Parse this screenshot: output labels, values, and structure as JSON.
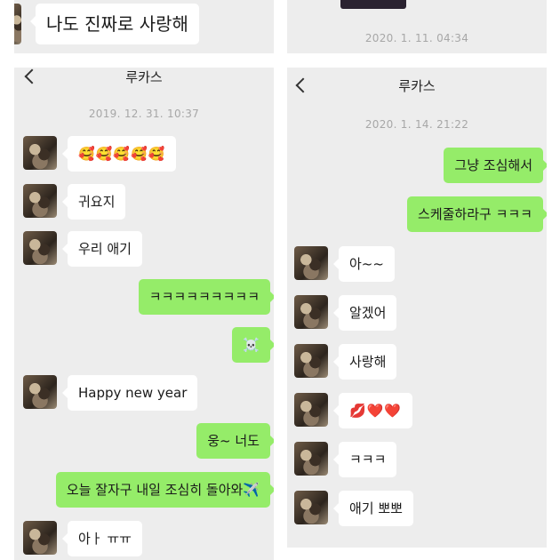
{
  "top_left": {
    "message": "나도 진짜로 사랑해"
  },
  "top_right": {
    "timestamp": "2020. 1. 11. 04:34"
  },
  "left_chat": {
    "contact_name": "루카스",
    "timestamp": "2019. 12. 31. 10:37",
    "messages": [
      {
        "side": "in",
        "text": "🥰🥰🥰🥰🥰"
      },
      {
        "side": "in",
        "text": "귀요지"
      },
      {
        "side": "in",
        "text": "우리 애기"
      },
      {
        "side": "out",
        "text": "ㅋㅋㅋㅋㅋㅋㅋㅋㅋ"
      },
      {
        "side": "out",
        "text": "☠️"
      },
      {
        "side": "in",
        "text": "Happy new year"
      },
      {
        "side": "out",
        "text": "웅~ 너도"
      },
      {
        "side": "out",
        "text": "오늘 잘자구 내일 조심히 돌아와✈️"
      },
      {
        "side": "in",
        "text": "아ㅏ ㅠㅠ"
      }
    ]
  },
  "right_chat": {
    "contact_name": "루카스",
    "timestamp": "2020. 1. 14. 21:22",
    "messages": [
      {
        "side": "out",
        "text": "그냥 조심해서"
      },
      {
        "side": "out",
        "text": "스케줄하라구 ㅋㅋㅋ"
      },
      {
        "side": "in",
        "text": "아~~"
      },
      {
        "side": "in",
        "text": "알겠어"
      },
      {
        "side": "in",
        "text": "사랑해"
      },
      {
        "side": "in",
        "text": "💋❤️❤️"
      },
      {
        "side": "in",
        "text": "ㅋㅋㅋ"
      },
      {
        "side": "in",
        "text": "애기 뽀뽀"
      }
    ]
  },
  "colors": {
    "outgoing_bubble": "#95ec69",
    "incoming_bubble": "#ffffff",
    "chat_bg": "#ededed"
  }
}
